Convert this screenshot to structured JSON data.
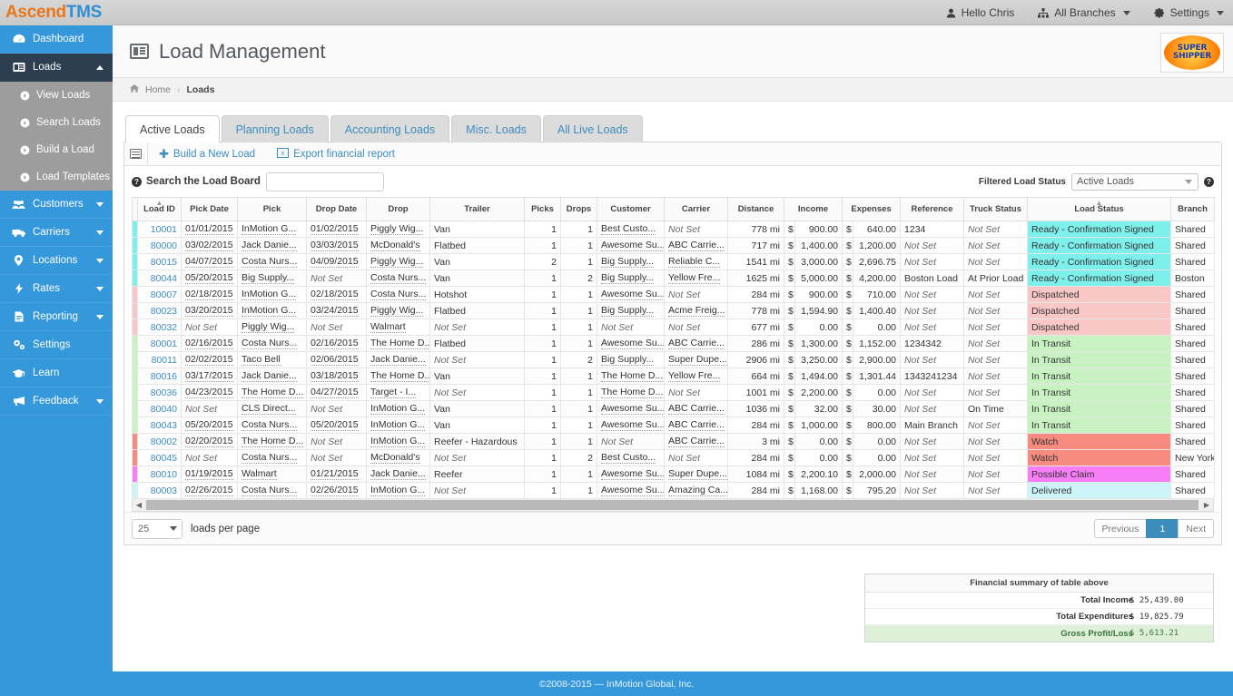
{
  "brand": {
    "part1": "Ascend",
    "part2": "TMS"
  },
  "topbar": {
    "user": "Hello Chris",
    "branches": "All Branches",
    "settings": "Settings"
  },
  "sidebar": {
    "items": [
      {
        "label": "Dashboard",
        "icon": "dashboard-icon",
        "caret": null,
        "active": false
      },
      {
        "label": "Loads",
        "icon": "loads-icon",
        "caret": "up",
        "active": true
      },
      {
        "label": "Customers",
        "icon": "customers-icon",
        "caret": "down",
        "active": false
      },
      {
        "label": "Carriers",
        "icon": "carriers-icon",
        "caret": "down",
        "active": false
      },
      {
        "label": "Locations",
        "icon": "location-pin-icon",
        "caret": "down",
        "active": false
      },
      {
        "label": "Rates",
        "icon": "bolt-icon",
        "caret": "down",
        "active": false
      },
      {
        "label": "Reporting",
        "icon": "document-icon",
        "caret": "down",
        "active": false
      },
      {
        "label": "Settings",
        "icon": "gear-icon",
        "caret": null,
        "active": false
      },
      {
        "label": "Learn",
        "icon": "graduation-cap-icon",
        "caret": null,
        "active": false
      },
      {
        "label": "Feedback",
        "icon": "megaphone-icon",
        "caret": "down",
        "active": false
      }
    ],
    "subitems": [
      {
        "label": "View Loads"
      },
      {
        "label": "Search Loads"
      },
      {
        "label": "Build a Load"
      },
      {
        "label": "Load Templates"
      }
    ]
  },
  "header": {
    "title": "Load Management",
    "logo_line1": "SUPER",
    "logo_line2": "SHIPPER"
  },
  "breadcrumb": {
    "home": "Home",
    "sep": "›",
    "current": "Loads"
  },
  "tabs": [
    {
      "label": "Active Loads",
      "active": true
    },
    {
      "label": "Planning Loads",
      "active": false
    },
    {
      "label": "Accounting Loads",
      "active": false
    },
    {
      "label": "Misc. Loads",
      "active": false
    },
    {
      "label": "All Live Loads",
      "active": false
    }
  ],
  "toolbar": {
    "build_new_load": "Build a New Load",
    "export_financial_report": "Export financial report"
  },
  "search": {
    "label": "Search the Load Board",
    "value": "",
    "placeholder": ""
  },
  "filter": {
    "label": "Filtered Load Status",
    "value": "Active Loads"
  },
  "table": {
    "columns": [
      "Load ID",
      "Pick Date",
      "Pick",
      "Drop Date",
      "Drop",
      "Trailer",
      "Picks",
      "Drops",
      "Customer",
      "Carrier",
      "Distance",
      "Income",
      "Expenses",
      "Reference",
      "Truck Status",
      "Load Status",
      "Branch"
    ],
    "sorted_columns": [
      "Load ID",
      "Load Status"
    ],
    "not_set": "Not Set",
    "currency": "$",
    "rows": [
      {
        "id": "10001",
        "pick_date": "01/01/2015",
        "pick": "InMotion G...",
        "drop_date": "01/02/2015",
        "drop": "Piggly Wig...",
        "trailer": "Van",
        "picks": "1",
        "drops": "1",
        "customer": "Best Custo...",
        "carrier": "Not Set",
        "distance": "778 mi",
        "income": "900.00",
        "expenses": "640.00",
        "reference": "1234",
        "truck_status": "Not Set",
        "load_status": "Ready - Confirmation Signed",
        "branch": "Shared",
        "status_color": "#7ef0ec"
      },
      {
        "id": "80000",
        "pick_date": "03/02/2015",
        "pick": "Jack Danie...",
        "drop_date": "03/03/2015",
        "drop": "McDonald's",
        "trailer": "Flatbed",
        "picks": "1",
        "drops": "1",
        "customer": "Awesome Su...",
        "carrier": "ABC Carrie...",
        "distance": "717 mi",
        "income": "1,400.00",
        "expenses": "1,200.00",
        "reference": "Not Set",
        "truck_status": "Not Set",
        "load_status": "Ready - Confirmation Signed",
        "branch": "Shared",
        "status_color": "#7ef0ec"
      },
      {
        "id": "80015",
        "pick_date": "04/07/2015",
        "pick": "Costa Nurs...",
        "drop_date": "04/09/2015",
        "drop": "Piggly Wig...",
        "trailer": "Van",
        "picks": "2",
        "drops": "1",
        "customer": "Big Supply...",
        "carrier": "Reliable C...",
        "distance": "1541 mi",
        "income": "3,000.00",
        "expenses": "2,696.75",
        "reference": "Not Set",
        "truck_status": "Not Set",
        "load_status": "Ready - Confirmation Signed",
        "branch": "Shared",
        "status_color": "#7ef0ec"
      },
      {
        "id": "80044",
        "pick_date": "05/20/2015",
        "pick": "Big Supply...",
        "drop_date": "Not Set",
        "drop": "Costa Nurs...",
        "trailer": "Van",
        "picks": "1",
        "drops": "2",
        "customer": "Big Supply...",
        "carrier": "Yellow Fre...",
        "distance": "1625 mi",
        "income": "5,000.00",
        "expenses": "4,200.00",
        "reference": "Boston Load",
        "truck_status": "At Prior Load",
        "load_status": "Ready - Confirmation Signed",
        "branch": "Boston",
        "status_color": "#7ef0ec"
      },
      {
        "id": "80007",
        "pick_date": "02/18/2015",
        "pick": "InMotion G...",
        "drop_date": "02/18/2015",
        "drop": "Costa Nurs...",
        "trailer": "Hotshot",
        "picks": "1",
        "drops": "1",
        "customer": "Awesome Su...",
        "carrier": "Not Set",
        "distance": "284 mi",
        "income": "900.00",
        "expenses": "710.00",
        "reference": "Not Set",
        "truck_status": "Not Set",
        "load_status": "Dispatched",
        "branch": "Shared",
        "status_color": "#fac7c7"
      },
      {
        "id": "80023",
        "pick_date": "03/20/2015",
        "pick": "InMotion G...",
        "drop_date": "03/24/2015",
        "drop": "Piggly Wig...",
        "trailer": "Flatbed",
        "picks": "1",
        "drops": "1",
        "customer": "Big Supply...",
        "carrier": "Acme Freig...",
        "distance": "778 mi",
        "income": "1,594.90",
        "expenses": "1,400.40",
        "reference": "Not Set",
        "truck_status": "Not Set",
        "load_status": "Dispatched",
        "branch": "Shared",
        "status_color": "#fac7c7"
      },
      {
        "id": "80032",
        "pick_date": "Not Set",
        "pick": "Piggly Wig...",
        "drop_date": "Not Set",
        "drop": "Walmart",
        "trailer": "Not Set",
        "picks": "1",
        "drops": "1",
        "customer": "Not Set",
        "carrier": "Not Set",
        "distance": "677 mi",
        "income": "0.00",
        "expenses": "0.00",
        "reference": "Not Set",
        "truck_status": "Not Set",
        "load_status": "Dispatched",
        "branch": "Shared",
        "status_color": "#fac7c7"
      },
      {
        "id": "80001",
        "pick_date": "02/16/2015",
        "pick": "Costa Nurs...",
        "drop_date": "02/16/2015",
        "drop": "The Home D...",
        "trailer": "Flatbed",
        "picks": "1",
        "drops": "1",
        "customer": "Awesome Su...",
        "carrier": "ABC Carrie...",
        "distance": "286 mi",
        "income": "1,300.00",
        "expenses": "1,152.00",
        "reference": "1234342",
        "truck_status": "Not Set",
        "load_status": "In Transit",
        "branch": "Shared",
        "status_color": "#c8f2c2"
      },
      {
        "id": "80011",
        "pick_date": "02/02/2015",
        "pick": "Taco Bell",
        "drop_date": "02/06/2015",
        "drop": "Jack Danie...",
        "trailer": "Not Set",
        "picks": "1",
        "drops": "2",
        "customer": "Big Supply...",
        "carrier": "Super Dupe...",
        "distance": "2906 mi",
        "income": "3,250.00",
        "expenses": "2,900.00",
        "reference": "Not Set",
        "truck_status": "Not Set",
        "load_status": "In Transit",
        "branch": "Shared",
        "status_color": "#c8f2c2"
      },
      {
        "id": "80016",
        "pick_date": "03/17/2015",
        "pick": "Jack Danie...",
        "drop_date": "03/18/2015",
        "drop": "The Home D...",
        "trailer": "Van",
        "picks": "1",
        "drops": "1",
        "customer": "The Home D...",
        "carrier": "Yellow Fre...",
        "distance": "664 mi",
        "income": "1,494.00",
        "expenses": "1,301.44",
        "reference": "1343241234",
        "truck_status": "Not Set",
        "load_status": "In Transit",
        "branch": "Shared",
        "status_color": "#c8f2c2"
      },
      {
        "id": "80036",
        "pick_date": "04/23/2015",
        "pick": "The Home D...",
        "drop_date": "04/27/2015",
        "drop": "Target - I...",
        "trailer": "Not Set",
        "picks": "1",
        "drops": "1",
        "customer": "The Home D...",
        "carrier": "Not Set",
        "distance": "1001 mi",
        "income": "2,200.00",
        "expenses": "0.00",
        "reference": "Not Set",
        "truck_status": "Not Set",
        "load_status": "In Transit",
        "branch": "Shared",
        "status_color": "#c8f2c2"
      },
      {
        "id": "80040",
        "pick_date": "Not Set",
        "pick": "CLS Direct...",
        "drop_date": "Not Set",
        "drop": "InMotion G...",
        "trailer": "Van",
        "picks": "1",
        "drops": "1",
        "customer": "Awesome Su...",
        "carrier": "ABC Carrie...",
        "distance": "1036 mi",
        "income": "32.00",
        "expenses": "30.00",
        "reference": "Not Set",
        "truck_status": "On Time",
        "load_status": "In Transit",
        "branch": "Shared",
        "status_color": "#c8f2c2"
      },
      {
        "id": "80043",
        "pick_date": "05/20/2015",
        "pick": "Costa Nurs...",
        "drop_date": "05/20/2015",
        "drop": "InMotion G...",
        "trailer": "Van",
        "picks": "1",
        "drops": "1",
        "customer": "Awesome Su...",
        "carrier": "ABC Carrie...",
        "distance": "284 mi",
        "income": "1,000.00",
        "expenses": "800.00",
        "reference": "Main Branch",
        "truck_status": "Not Set",
        "load_status": "In Transit",
        "branch": "Shared",
        "status_color": "#c8f2c2"
      },
      {
        "id": "80002",
        "pick_date": "02/20/2015",
        "pick": "The Home D...",
        "drop_date": "Not Set",
        "drop": "InMotion G...",
        "trailer": "Reefer - Hazardous",
        "picks": "1",
        "drops": "1",
        "customer": "Not Set",
        "carrier": "ABC Carrie...",
        "distance": "3 mi",
        "income": "0.00",
        "expenses": "0.00",
        "reference": "Not Set",
        "truck_status": "Not Set",
        "load_status": "Watch",
        "branch": "Shared",
        "status_color": "#f78b80"
      },
      {
        "id": "80045",
        "pick_date": "Not Set",
        "pick": "Costa Nurs...",
        "drop_date": "Not Set",
        "drop": "McDonald's",
        "trailer": "Not Set",
        "picks": "1",
        "drops": "2",
        "customer": "Best Custo...",
        "carrier": "Not Set",
        "distance": "284 mi",
        "income": "0.00",
        "expenses": "0.00",
        "reference": "Not Set",
        "truck_status": "Not Set",
        "load_status": "Watch",
        "branch": "New York",
        "status_color": "#f78b80"
      },
      {
        "id": "80010",
        "pick_date": "01/19/2015",
        "pick": "Walmart",
        "drop_date": "01/21/2015",
        "drop": "Jack Danie...",
        "trailer": "Reefer",
        "picks": "1",
        "drops": "1",
        "customer": "Awesome Su...",
        "carrier": "Super Dupe...",
        "distance": "1084 mi",
        "income": "2,200.10",
        "expenses": "2,000.00",
        "reference": "Not Set",
        "truck_status": "Not Set",
        "load_status": "Possible Claim",
        "branch": "Shared",
        "status_color": "#f77ef7"
      },
      {
        "id": "80003",
        "pick_date": "02/26/2015",
        "pick": "Costa Nurs...",
        "drop_date": "02/26/2015",
        "drop": "InMotion G...",
        "trailer": "Not Set",
        "picks": "1",
        "drops": "1",
        "customer": "Awesome Su...",
        "carrier": "Amazing Ca...",
        "distance": "284 mi",
        "income": "1,168.00",
        "expenses": "795.20",
        "reference": "Not Set",
        "truck_status": "Not Set",
        "load_status": "Delivered",
        "branch": "Shared",
        "status_color": "#cdf4f8"
      }
    ]
  },
  "pagination": {
    "per_page": "25",
    "per_page_label": "loads per page",
    "previous": "Previous",
    "page": "1",
    "next": "Next"
  },
  "financial_summary": {
    "title": "Financial summary of table above",
    "rows": [
      {
        "label": "Total Income",
        "currency": "$",
        "value": "25,439.00"
      },
      {
        "label": "Total Expenditures",
        "currency": "$",
        "value": "19,825.79"
      },
      {
        "label": "Gross Profit/Loss",
        "currency": "$",
        "value": "5,613.21",
        "total": true
      }
    ]
  },
  "footer": {
    "copyright": "©2008-2015 — InMotion Global, Inc."
  }
}
